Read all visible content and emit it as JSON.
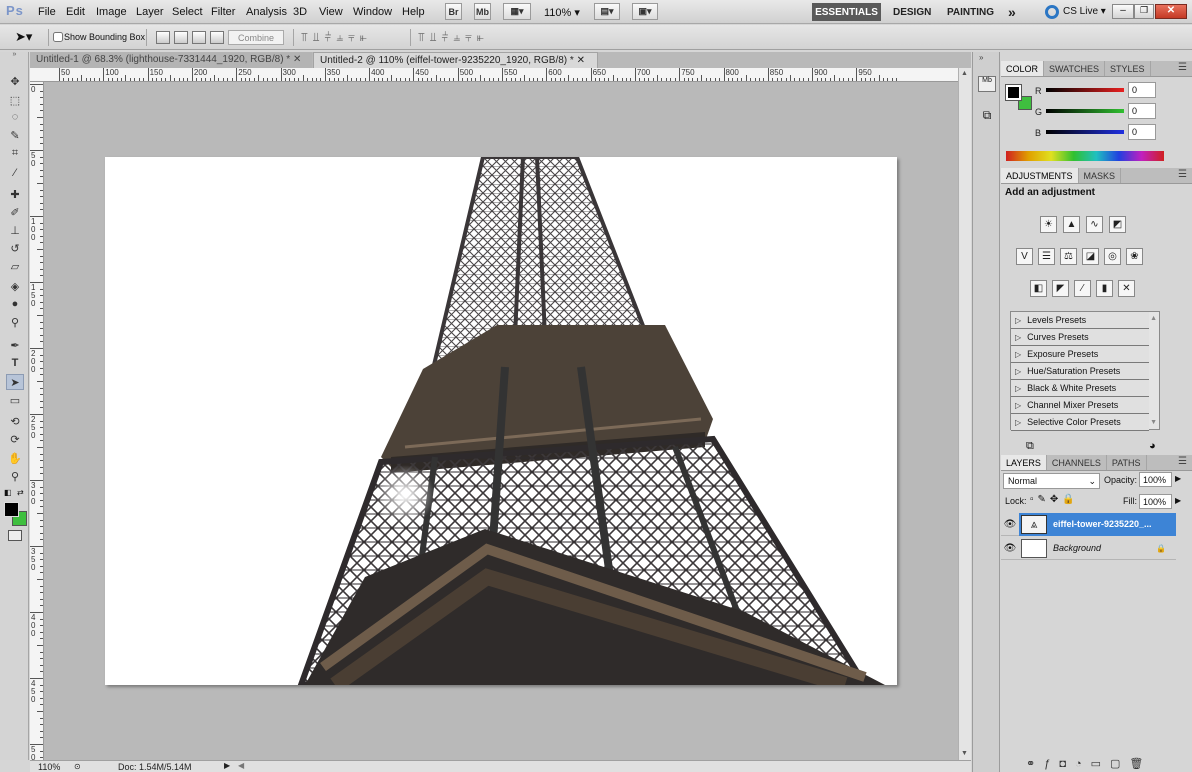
{
  "app": {
    "logo": "Ps"
  },
  "menu": [
    "File",
    "Edit",
    "Image",
    "Layer",
    "Select",
    "Filter",
    "Analysis",
    "3D",
    "View",
    "Window",
    "Help"
  ],
  "appbar": {
    "bridge": "Br",
    "minibridge": "Mb",
    "zoom": "110%"
  },
  "workspaces": {
    "active": "ESSENTIALS",
    "design": "DESIGN",
    "painting": "PAINTING",
    "more": "»",
    "cslive": "CS Live"
  },
  "options": {
    "show_bounding_box": "Show Bounding Box",
    "combine": "Combine"
  },
  "tabs": [
    {
      "title": "Untitled-1 @ 68.3% (lighthouse-7331444_1920, RGB/8) *"
    },
    {
      "title": "Untitled-2 @ 110% (eiffel-tower-9235220_1920, RGB/8) *"
    }
  ],
  "ruler_h": [
    "50",
    "100",
    "150",
    "200",
    "250",
    "300",
    "350",
    "400",
    "450",
    "500",
    "550",
    "600",
    "650",
    "700",
    "750",
    "800",
    "850",
    "900",
    "950"
  ],
  "ruler_v": [
    "0",
    "5 0",
    "1 0 0",
    "1 5 0",
    "2 0 0",
    "2 5 0",
    "3 0 0",
    "3 5 0",
    "4 0 0",
    "4 5 0",
    "5 0 0"
  ],
  "status": {
    "zoom": "110%",
    "doc": "Doc: 1.54M/5.14M"
  },
  "color_panel": {
    "tabs": [
      "COLOR",
      "SWATCHES",
      "STYLES"
    ],
    "channels": [
      {
        "label": "R",
        "value": "0",
        "color": "#c0201e"
      },
      {
        "label": "G",
        "value": "0",
        "color": "#34a033"
      },
      {
        "label": "B",
        "value": "0",
        "color": "#1a3ad6"
      }
    ],
    "foreground": "#000000",
    "background": "#3fbf3f"
  },
  "adjustments": {
    "tabs": [
      "ADJUSTMENTS",
      "MASKS"
    ],
    "heading": "Add an adjustment",
    "presets": [
      "Levels Presets",
      "Curves Presets",
      "Exposure Presets",
      "Hue/Saturation Presets",
      "Black & White Presets",
      "Channel Mixer Presets",
      "Selective Color Presets"
    ]
  },
  "layers_panel": {
    "tabs": [
      "LAYERS",
      "CHANNELS",
      "PATHS"
    ],
    "blend_mode": "Normal",
    "opacity_label": "Opacity:",
    "opacity": "100%",
    "lock_label": "Lock:",
    "fill_label": "Fill:",
    "fill": "100%",
    "layers": [
      {
        "name": "eiffel-tower-9235220_...",
        "selected": true
      },
      {
        "name": "Background",
        "selected": false
      }
    ]
  }
}
